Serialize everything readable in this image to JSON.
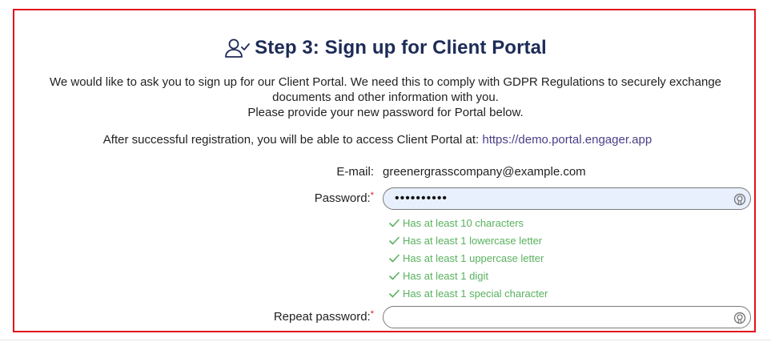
{
  "step": {
    "title": "Step 3: Sign up for Client Portal",
    "icon": "user-check-icon"
  },
  "intro": {
    "line1": "We would like to ask you to sign up for our Client Portal. We need this to comply with GDPR Regulations to securely exchange documents and other information with you.",
    "line2": "Please provide your new password for Portal below."
  },
  "access": {
    "text": "After successful registration, you will be able to access Client Portal at: ",
    "url": "https://demo.portal.engager.app"
  },
  "form": {
    "email_label": "E-mail:",
    "email_value": "greenergrasscompany@example.com",
    "password_label": "Password:",
    "password_masked": "••••••••••",
    "repeat_label": "Repeat password:",
    "required_mark": "*"
  },
  "rules": [
    "Has at least 10 characters",
    "Has at least 1 lowercase letter",
    "Has at least 1 uppercase letter",
    "Has at least 1 digit",
    "Has at least 1 special character"
  ],
  "colors": {
    "title": "#1d2b57",
    "frame": "#e0141c",
    "rule_ok": "#58b15e",
    "link": "#4b3d86",
    "autofill_bg": "#e8f0fe"
  }
}
